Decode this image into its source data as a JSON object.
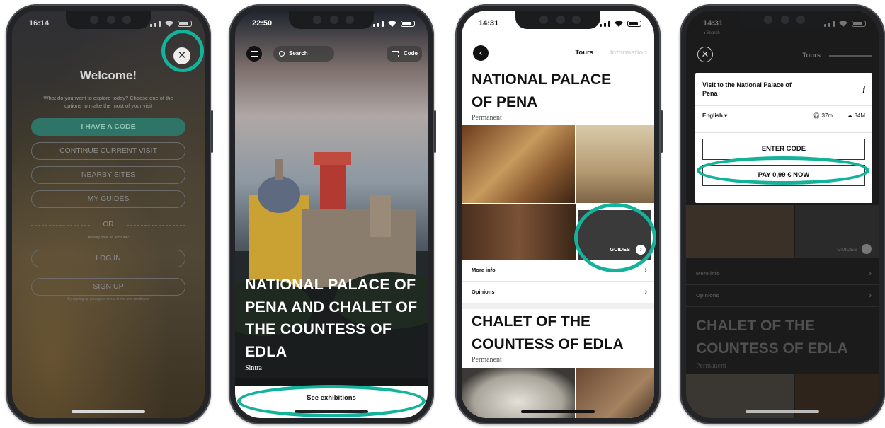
{
  "phone1": {
    "time": "16:14",
    "close_icon": "close-circle-icon",
    "title": "Welcome!",
    "subtitle": "What do you want to explore today? Choose one of the options to make the most of your visit",
    "options": [
      "I HAVE A CODE",
      "CONTINUE CURRENT VISIT",
      "NEARBY SITES",
      "MY GUIDES"
    ],
    "or_label": "OR",
    "account_prompt": "Already have an account?",
    "login_label": "LOG IN",
    "signup_label": "SIGN UP",
    "terms": "By signing up you agree to our terms and conditions"
  },
  "phone2": {
    "time": "22:50",
    "search_label": "Search",
    "code_label": "Code",
    "title": "NATIONAL PALACE OF PENA AND CHALET OF THE COUNTESS OF EDLA",
    "place": "Sintra",
    "cta": "See exhibitions"
  },
  "phone3": {
    "time": "14:31",
    "tabs": [
      "Tours",
      "Information"
    ],
    "exhibit1_title": "NATIONAL PALACE OF PENA",
    "exhibit1_type": "Permanent",
    "guides_label": "GUIDES",
    "rows": [
      "More info",
      "Opinions"
    ],
    "exhibit2_title": "CHALET OF THE COUNTESS OF EDLA",
    "exhibit2_type": "Permanent"
  },
  "phone4": {
    "time": "14:31",
    "back_hint": "◂ Search",
    "tab": "Tours",
    "visit_name": "Visit to the National Palace of Pena",
    "language": "English",
    "duration": "37m",
    "size": "34M",
    "enter_code": "ENTER CODE",
    "pay_now": "PAY 0,99 € NOW",
    "guides_label": "GUIDES",
    "rows": [
      "More info",
      "Opinions"
    ],
    "exhibit_title": "CHALET OF THE COUNTESS OF EDLA",
    "exhibit_type": "Permanent"
  },
  "accent_color": "#13b29a"
}
